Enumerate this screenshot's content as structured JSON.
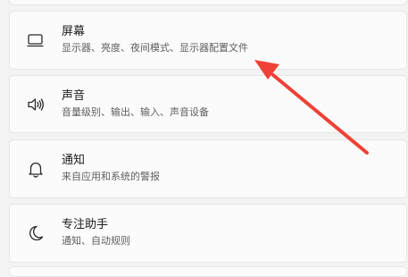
{
  "settings": {
    "items": [
      {
        "title": "屏幕",
        "subtitle": "显示器、亮度、夜间模式、显示器配置文件",
        "icon": "monitor-icon"
      },
      {
        "title": "声音",
        "subtitle": "音量级别、输出、输入、声音设备",
        "icon": "speaker-icon"
      },
      {
        "title": "通知",
        "subtitle": "来自应用和系统的警报",
        "icon": "bell-icon"
      },
      {
        "title": "专注助手",
        "subtitle": "通知、自动规则",
        "icon": "moon-icon"
      }
    ]
  },
  "annotation": {
    "arrow_color": "#ef4136"
  }
}
